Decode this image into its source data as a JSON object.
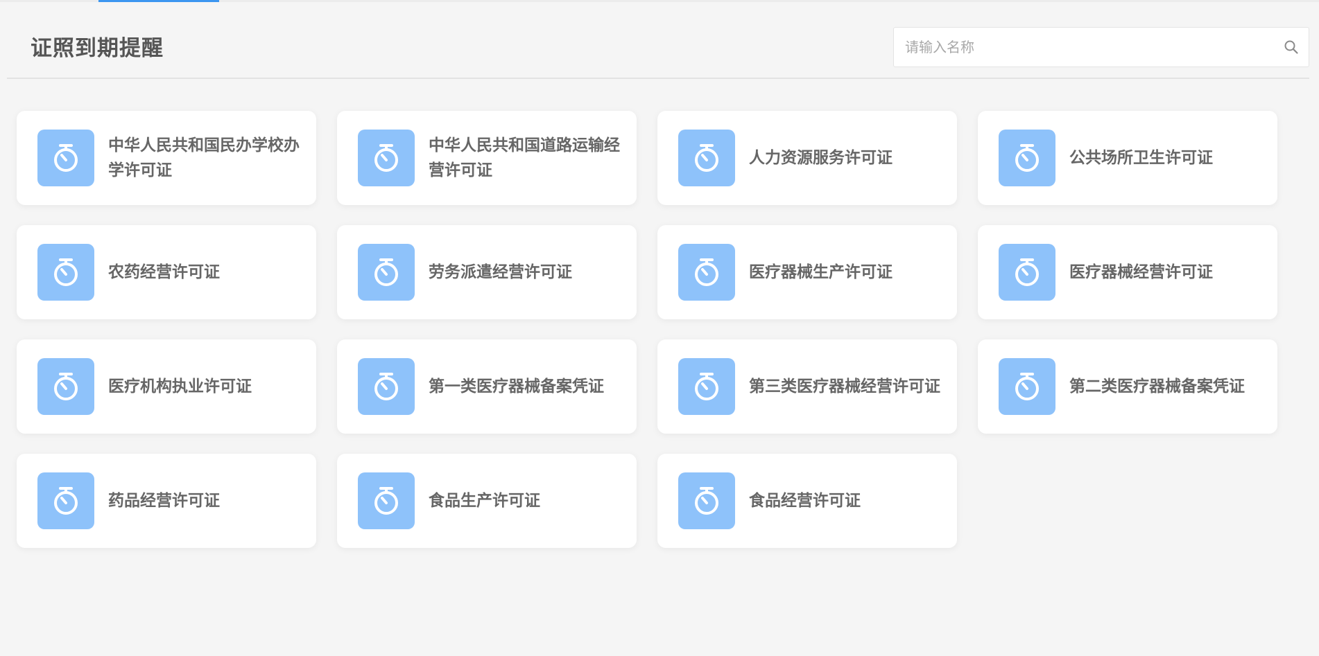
{
  "header": {
    "title": "证照到期提醒"
  },
  "search": {
    "placeholder": "请输入名称",
    "value": ""
  },
  "colors": {
    "accent": "#3c96f0",
    "icon_tile": "#8ec2fa",
    "background": "#f5f5f5",
    "card": "#ffffff",
    "title_text": "#555555",
    "label_text": "#666666"
  },
  "icons": {
    "card": "stopwatch-icon",
    "search": "search-icon"
  },
  "cards": [
    {
      "label": "中华人民共和国民办学校办学许可证"
    },
    {
      "label": "中华人民共和国道路运输经营许可证"
    },
    {
      "label": "人力资源服务许可证"
    },
    {
      "label": "公共场所卫生许可证"
    },
    {
      "label": "农药经营许可证"
    },
    {
      "label": "劳务派遣经营许可证"
    },
    {
      "label": "医疗器械生产许可证"
    },
    {
      "label": "医疗器械经营许可证"
    },
    {
      "label": "医疗机构执业许可证"
    },
    {
      "label": "第一类医疗器械备案凭证"
    },
    {
      "label": "第三类医疗器械经营许可证"
    },
    {
      "label": "第二类医疗器械备案凭证"
    },
    {
      "label": "药品经营许可证"
    },
    {
      "label": "食品生产许可证"
    },
    {
      "label": "食品经营许可证"
    }
  ]
}
